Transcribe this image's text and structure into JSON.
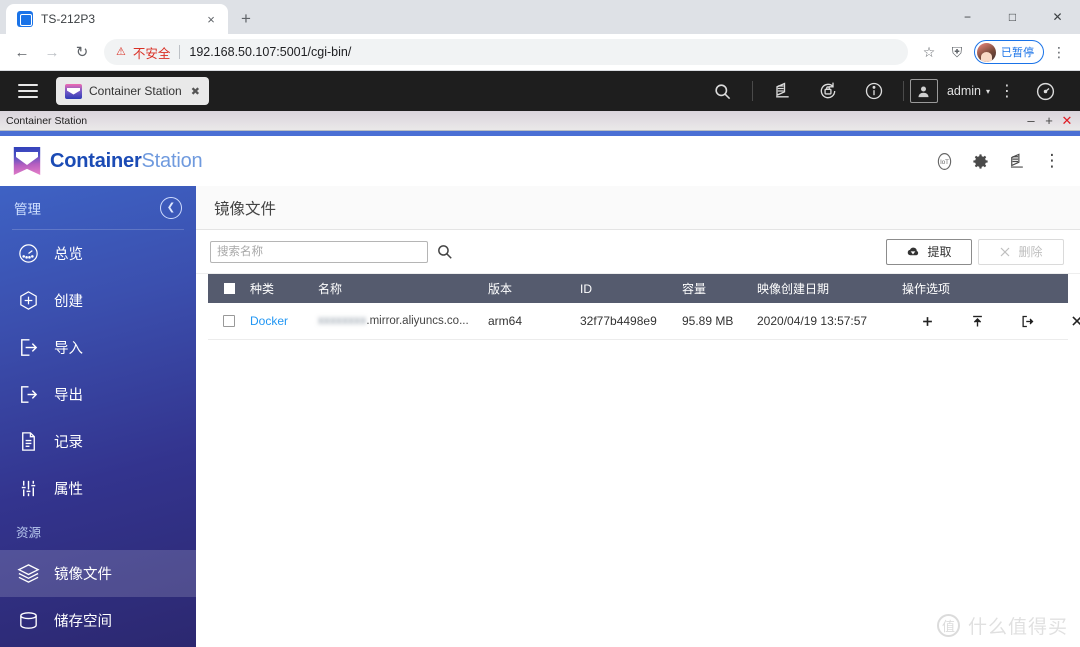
{
  "browser": {
    "tab": {
      "title": "TS-212P3",
      "favicon": "qnap-favicon",
      "close_label": "×"
    },
    "newtab_label": "+",
    "window_controls": {
      "minimize": "−",
      "maximize": "□",
      "close": "✕"
    },
    "nav": {
      "back": "←",
      "forward": "→",
      "reload": "↻"
    },
    "omnibox": {
      "warning_icon": "⚠",
      "warning_text": "不安全",
      "url": "192.168.50.107:5001/cgi-bin/"
    },
    "toolbar": {
      "bookmark": "☆",
      "extension": "⛨",
      "profile_chip_label": "已暂停",
      "menu": "⋮"
    }
  },
  "qnap_desktop": {
    "menu_button": "hamburger-menu",
    "app_tab": {
      "label": "Container Station",
      "close": "✖"
    },
    "icons": {
      "search": "search-icon",
      "notifications": "notification-icon",
      "background_tasks": "background-task-icon",
      "info": "info-icon",
      "user": "user-avatar-icon",
      "dashboard": "dashboard-icon",
      "more": "⋮"
    },
    "admin_label": "admin",
    "admin_caret": "▾"
  },
  "cs_window": {
    "titlebar": {
      "title": "Container Station",
      "minimize": "–",
      "maximize": "+",
      "close": "✕"
    },
    "brand": {
      "bold": "Container",
      "light": "Station"
    },
    "header_icons": {
      "iot": "IoT",
      "settings": "gear-icon",
      "notifications": "notification-icon",
      "more": "⋮"
    }
  },
  "sidebar": {
    "section_manage": "管理",
    "collapse_icon": "❮",
    "items_manage": [
      {
        "label": "总览",
        "icon": "overview-gauge-icon",
        "active": false
      },
      {
        "label": "创建",
        "icon": "create-plus-hex-icon",
        "active": false
      },
      {
        "label": "导入",
        "icon": "import-arrow-icon",
        "active": false
      },
      {
        "label": "导出",
        "icon": "export-arrow-icon",
        "active": false
      },
      {
        "label": "记录",
        "icon": "logs-document-icon",
        "active": false
      },
      {
        "label": "属性",
        "icon": "properties-sliders-icon",
        "active": false
      }
    ],
    "section_resources": "资源",
    "items_resources": [
      {
        "label": "镜像文件",
        "icon": "images-layers-icon",
        "active": true
      },
      {
        "label": "储存空间",
        "icon": "storage-cylinder-icon",
        "active": false
      }
    ]
  },
  "main": {
    "page_title": "镜像文件",
    "search_placeholder": "搜索名称",
    "search_value": "",
    "search_icon": "search-icon",
    "buttons": {
      "pull": {
        "label": "提取",
        "icon": "cloud-download-icon",
        "disabled": false
      },
      "delete": {
        "label": "删除",
        "icon": "close-x-icon",
        "disabled": true
      }
    },
    "table": {
      "columns": [
        "",
        "种类",
        "名称",
        "版本",
        "ID",
        "容量",
        "映像创建日期",
        "操作选项"
      ],
      "rows": [
        {
          "kind": "Docker",
          "name_redacted": "xxxxxxxx",
          "name_suffix": ".mirror.aliyuncs.co...",
          "version": "arm64",
          "id": "32f77b4498e9",
          "size": "95.89 MB",
          "created": "2020/04/19 13:57:57",
          "actions": [
            "create-container-plus-icon",
            "push-upload-icon",
            "export-icon",
            "delete-x-icon"
          ]
        }
      ]
    }
  },
  "watermark": {
    "logo": "值",
    "text": "什么值得买"
  },
  "colors": {
    "accent_blue": "#4a6fd4",
    "brand_blue": "#1b4bb5",
    "sidebar_top": "#3e62c4",
    "sidebar_bottom": "#2c2870",
    "table_header": "#555b6e",
    "link_blue": "#2196f3",
    "warning_red": "#d93025"
  }
}
